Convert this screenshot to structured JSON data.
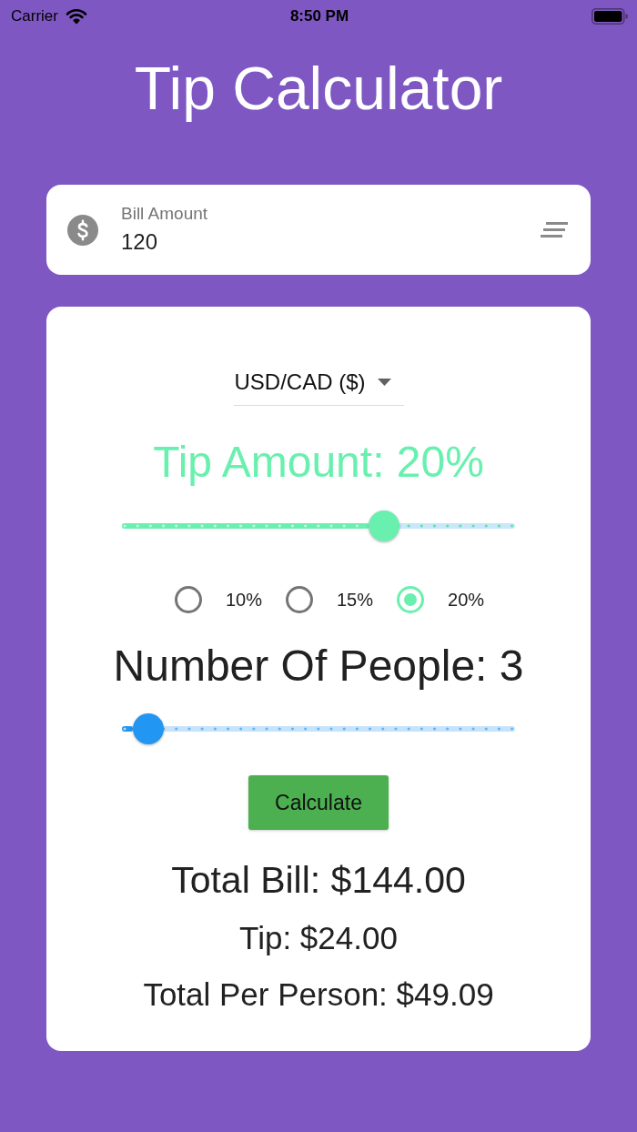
{
  "status_bar": {
    "carrier": "Carrier",
    "time": "8:50 PM"
  },
  "title": "Tip Calculator",
  "bill_field": {
    "label": "Bill Amount",
    "value": "120"
  },
  "currency_dropdown": {
    "value": "USD/CAD ($)"
  },
  "tip": {
    "heading": "Tip Amount: 20%",
    "slider": {
      "level": 0.667
    },
    "options": [
      {
        "label": "10%",
        "selected": false
      },
      {
        "label": "15%",
        "selected": false
      },
      {
        "label": "20%",
        "selected": true
      }
    ]
  },
  "people": {
    "heading": "Number Of People: 3",
    "slider": {
      "level": 0.067
    }
  },
  "calculate_button": {
    "label": "Calculate"
  },
  "results": [
    {
      "kind": "total",
      "text": "Total Bill: $144.00"
    },
    {
      "kind": "line",
      "text": "Tip: $24.00"
    },
    {
      "kind": "line",
      "text": "Total Per Person: $49.09"
    }
  ]
}
